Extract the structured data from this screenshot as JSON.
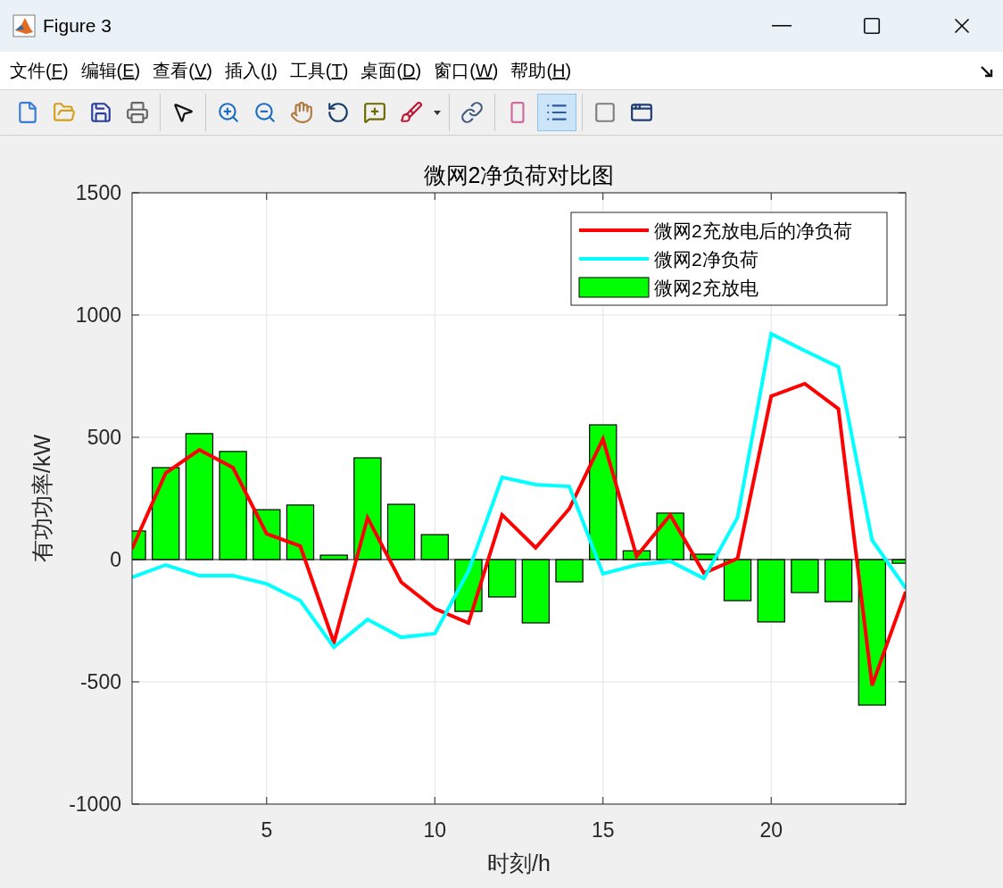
{
  "window": {
    "title": "Figure 3"
  },
  "menu": [
    {
      "label": "文件(F)"
    },
    {
      "label": "编辑(E)"
    },
    {
      "label": "查看(V)"
    },
    {
      "label": "插入(I)"
    },
    {
      "label": "工具(T)"
    },
    {
      "label": "桌面(D)"
    },
    {
      "label": "窗口(W)"
    },
    {
      "label": "帮助(H)"
    }
  ],
  "toolbar": [
    [
      {
        "kind": "new",
        "selected": false
      },
      {
        "kind": "open",
        "selected": false
      },
      {
        "kind": "save",
        "selected": false
      },
      {
        "kind": "print",
        "selected": false
      }
    ],
    [
      {
        "kind": "pointer",
        "selected": false
      }
    ],
    [
      {
        "kind": "zoom_in",
        "selected": false
      },
      {
        "kind": "zoom_out",
        "selected": false
      },
      {
        "kind": "pan",
        "selected": false
      },
      {
        "kind": "rotate",
        "selected": false
      },
      {
        "kind": "datatip",
        "selected": false
      },
      {
        "kind": "brush",
        "selected": false
      },
      {
        "kind": "dropdown",
        "selected": false
      }
    ],
    [
      {
        "kind": "link",
        "selected": false
      }
    ],
    [
      {
        "kind": "colorbar",
        "selected": false
      },
      {
        "kind": "legend",
        "selected": true
      }
    ],
    [
      {
        "kind": "hide_tools",
        "selected": false
      },
      {
        "kind": "show_tools",
        "selected": false
      }
    ]
  ],
  "figure": {
    "chart_data": {
      "type": "bar",
      "title": "微网2净负荷对比图",
      "xlabel": "时刻/h",
      "ylabel": "有功功率/kW",
      "x": [
        1,
        2,
        3,
        4,
        5,
        6,
        7,
        8,
        9,
        10,
        11,
        12,
        13,
        14,
        15,
        16,
        17,
        18,
        19,
        20,
        21,
        22,
        23,
        24
      ],
      "series": [
        {
          "name": "微网2充放电后的净负荷",
          "type": "line",
          "color": "#ff0000",
          "values": [
            44,
            354,
            449,
            376,
            105,
            55,
            -340,
            171,
            -92,
            -201,
            -259,
            183,
            48,
            208,
            493,
            14,
            183,
            -55,
            4,
            668,
            719,
            616,
            -515,
            -132
          ]
        },
        {
          "name": "微网2净负荷",
          "type": "line",
          "color": "#00ffff",
          "values": [
            -73,
            -22,
            -66,
            -66,
            -99,
            -168,
            -358,
            -245,
            -318,
            -303,
            -47,
            336,
            307,
            299,
            -58,
            -22,
            -7,
            -77,
            172,
            923,
            854,
            788,
            80,
            -117
          ]
        },
        {
          "name": "微网2充放电",
          "color": "#00ff00",
          "values": [
            117,
            376,
            515,
            442,
            204,
            223,
            18,
            416,
            226,
            102,
            -212,
            -153,
            -259,
            -91,
            551,
            36,
            190,
            22,
            -168,
            -255,
            -135,
            -172,
            -595,
            -15
          ]
        }
      ],
      "grid": true,
      "legend": true,
      "xlim": [
        1,
        24
      ],
      "ylim": [
        -1000,
        1500
      ],
      "xticks": [
        5,
        10,
        15,
        20
      ],
      "yticks": [
        -1000,
        -500,
        0,
        500,
        1000,
        1500
      ]
    }
  }
}
